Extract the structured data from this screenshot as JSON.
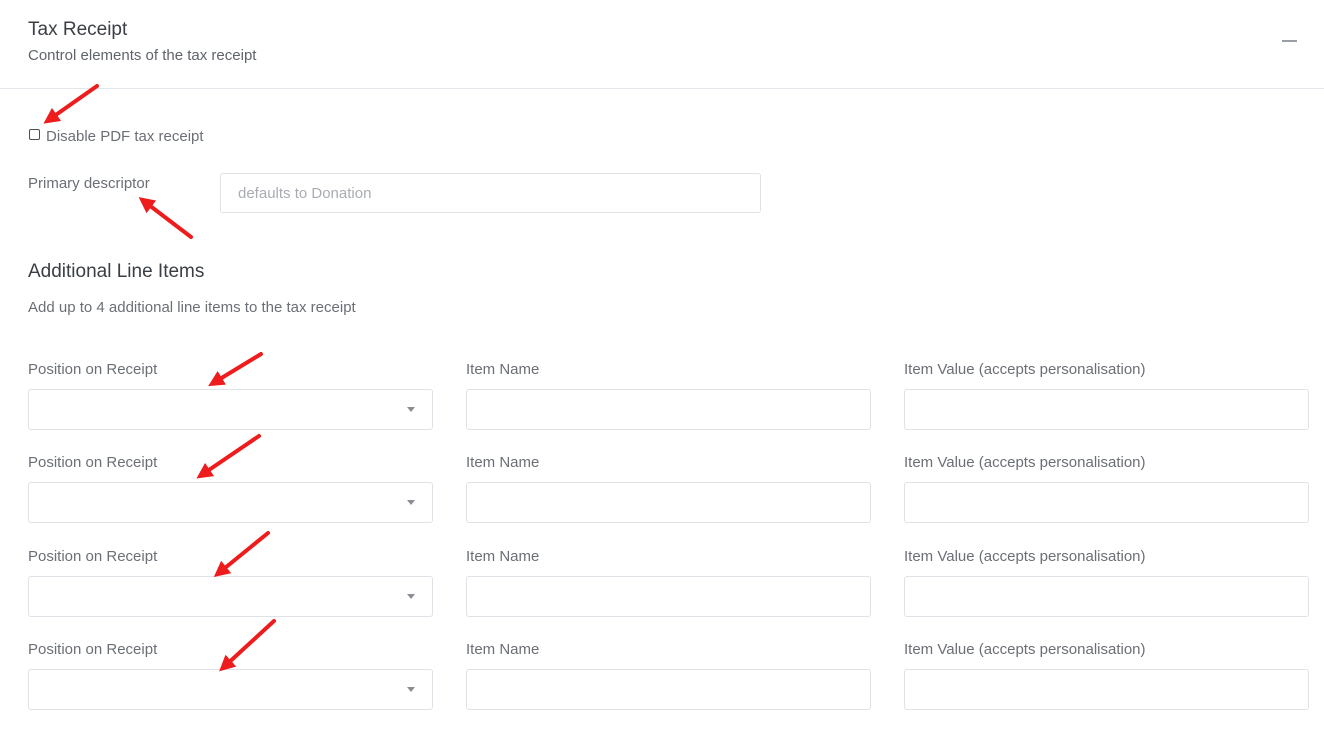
{
  "panel": {
    "title": "Tax Receipt",
    "subtitle": "Control elements of the tax receipt",
    "collapse_icon": "minus-icon"
  },
  "disable_pdf": {
    "label": "Disable PDF tax receipt",
    "checked": false
  },
  "primary_descriptor": {
    "label": "Primary descriptor",
    "placeholder": "defaults to Donation",
    "value": ""
  },
  "additional_items": {
    "title": "Additional Line Items",
    "description": "Add up to 4 additional line items to the tax receipt",
    "rows": [
      {
        "position_label": "Position on Receipt",
        "name_label": "Item Name",
        "value_label": "Item Value (accepts personalisation)",
        "position": "",
        "name": "",
        "value": ""
      },
      {
        "position_label": "Position on Receipt",
        "name_label": "Item Name",
        "value_label": "Item Value (accepts personalisation)",
        "position": "",
        "name": "",
        "value": ""
      },
      {
        "position_label": "Position on Receipt",
        "name_label": "Item Name",
        "value_label": "Item Value (accepts personalisation)",
        "position": "",
        "name": "",
        "value": ""
      },
      {
        "position_label": "Position on Receipt",
        "name_label": "Item Name",
        "value_label": "Item Value (accepts personalisation)",
        "position": "",
        "name": "",
        "value": ""
      }
    ]
  },
  "colors": {
    "annotation_arrow": "#ee1c1c",
    "border": "#dfe2e6",
    "text": "#6b6f76",
    "heading": "#3a3f45"
  }
}
